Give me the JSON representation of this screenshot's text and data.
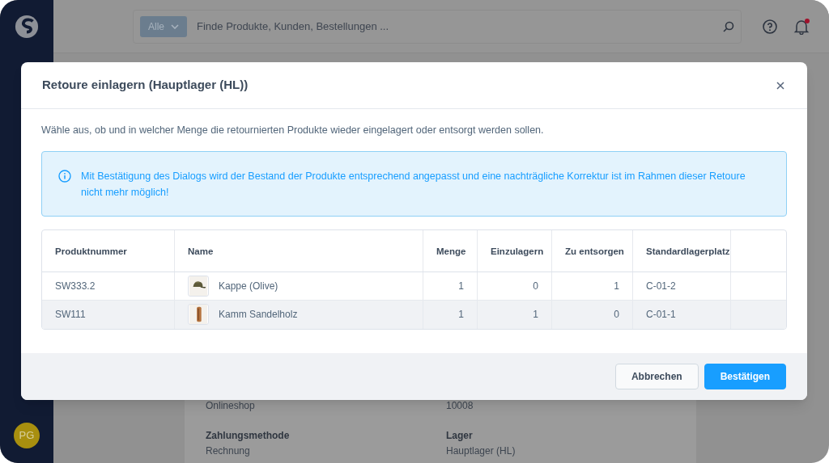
{
  "topbar": {
    "search": {
      "filter": "Alle",
      "placeholder": "Finde Produkte, Kunden, Bestellungen ..."
    },
    "notification_badge": true
  },
  "sidebar": {
    "avatar": "PG"
  },
  "background_details": [
    {
      "value": "Onlineshop"
    },
    {
      "value": "10008"
    },
    {
      "label": "Zahlungsmethode",
      "value": "Rechnung"
    },
    {
      "label": "Lager",
      "value": "Hauptlager (HL)"
    }
  ],
  "dialog": {
    "title": "Retoure einlagern (Hauptlager (HL))",
    "description": "Wähle aus, ob und in welcher Menge die retournierten Produkte wieder eingelagert oder entsorgt werden sollen.",
    "info": "Mit Bestätigung des Dialogs wird der Bestand der Produkte entsprechend angepasst und eine nachträgliche Korrektur ist im Rahmen dieser Retoure nicht mehr möglich!",
    "table": {
      "columns": [
        "Produktnummer",
        "Name",
        "Menge",
        "Einzulagern",
        "Zu entsorgen",
        "Standardlagerplatz"
      ],
      "rows": [
        {
          "product_number": "SW333.2",
          "name": "Kappe (Olive)",
          "quantity": "1",
          "to_store": "0",
          "to_dispose": "1",
          "storage_location": "C-01-2"
        },
        {
          "product_number": "SW111",
          "name": "Kamm Sandelholz",
          "quantity": "1",
          "to_store": "1",
          "to_dispose": "0",
          "storage_location": "C-01-1"
        }
      ]
    },
    "buttons": [
      {
        "label": "Abbrechen",
        "kind": "secondary"
      },
      {
        "label": "Bestätigen",
        "kind": "primary"
      }
    ]
  }
}
